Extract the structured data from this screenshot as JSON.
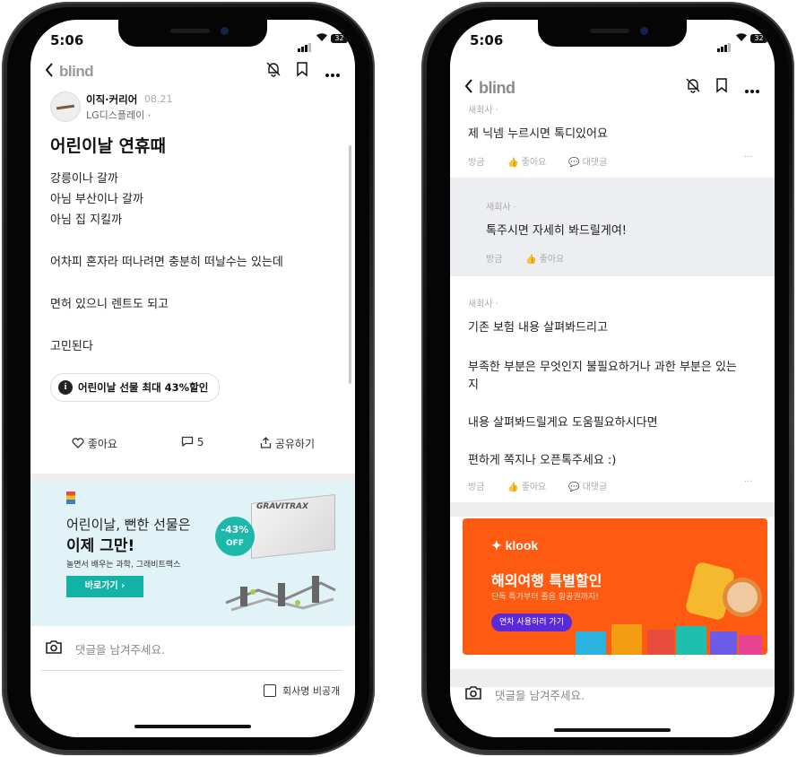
{
  "status": {
    "time": "5:06",
    "battery": "32"
  },
  "app": {
    "logo": "blind"
  },
  "left": {
    "author": {
      "category": "이직·커리어",
      "date": "08.21",
      "company": "LG디스플레이 ·"
    },
    "post": {
      "title": "어린이날 연휴때",
      "lines": [
        "강릉이나 갈까",
        "아님 부산이나 갈까",
        "아님 집 지킬까",
        "어차피 혼자라 떠나려면 충분히 떠날수는 있는데",
        "면허 있으니 렌트도 되고",
        "고민된다"
      ]
    },
    "event_chip": "어린이날 선물 최대 43%할인",
    "actions": {
      "like": "좋아요",
      "comments": "5",
      "share": "공유하기"
    },
    "ad": {
      "line1": "어린이날, 뻔한 선물은",
      "line2": "이제 그만!",
      "line3": "놀면서 배우는 과학, 그래비트랙스",
      "cta": "바로가기 ›",
      "badge_pct": "-43%",
      "badge_off": "OFF",
      "product": "GRAVITRAX"
    },
    "comment_placeholder": "댓글을 남겨주세요.",
    "anon_label": "회사명 비공개"
  },
  "right": {
    "comment1": {
      "company": "새회사 ·",
      "text": "제 닉넴 누르시면 톡디있어요",
      "time": "방금",
      "like": "좋아요",
      "reply": "대댓글"
    },
    "reply1": {
      "company": "새회사 ·",
      "text": "톡주시면 자세히 봐드릴게여!",
      "time": "방금",
      "like": "좋아요"
    },
    "comment2": {
      "company": "새회사 ·",
      "lines": [
        "기존 보험 내용 살펴봐드리고",
        "부족한 부분은 무엇인지 불필요하거나 과한 부분은 있는",
        "지",
        "내용 살펴봐드릴게요 도움필요하시다면",
        "편하게 쪽지나 오픈톡주세요 :)"
      ],
      "time": "방금",
      "like": "좋아요",
      "reply": "대댓글"
    },
    "ad": {
      "brand": "klook",
      "title": "해외여행 특별할인",
      "subtitle": "단독 특가부터 졸음 항공권까지!",
      "cta": "연차 사용하러 가기"
    },
    "comment_placeholder": "댓글을 남겨주세요."
  },
  "colors": {
    "ad_teal": "#12b3a6",
    "klook_orange": "#ff5a12",
    "klook_purple": "#5a2ad8",
    "ad_bg": "#e2f3f8"
  }
}
